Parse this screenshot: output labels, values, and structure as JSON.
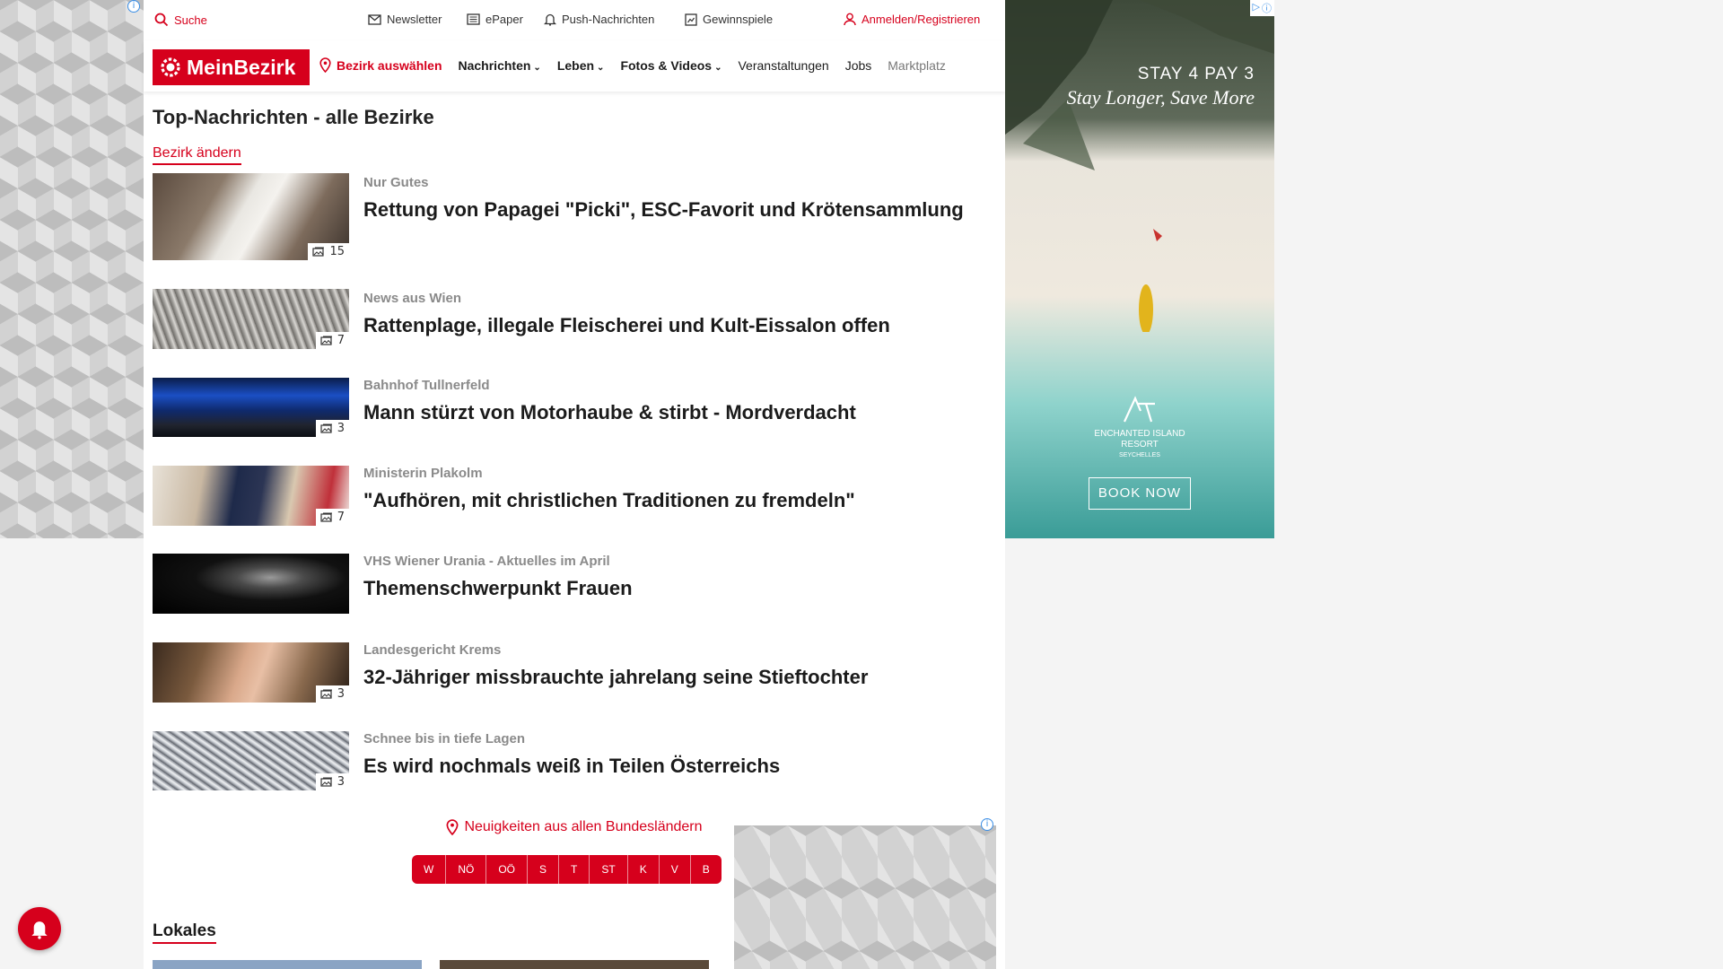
{
  "topbar": {
    "search": "Suche",
    "newsletter": "Newsletter",
    "epaper": "ePaper",
    "push": "Push-Nachrichten",
    "games": "Gewinnspiele",
    "login": "Anmelden/Registrieren"
  },
  "nav": {
    "logo": "MeinBezirk",
    "select_district": "Bezirk auswählen",
    "items": [
      "Nachrichten",
      "Leben",
      "Fotos & Videos",
      "Veranstaltungen",
      "Jobs",
      "Marktplatz"
    ]
  },
  "main": {
    "title": "Top-Nachrichten - alle Bezirke",
    "change_district": "Bezirk ändern",
    "articles": [
      {
        "kicker": "Nur Gutes",
        "headline": "Rettung von Papagei \"Picki\", ESC-Favorit und Krötensammlung",
        "photos": "15"
      },
      {
        "kicker": "News aus Wien",
        "headline": "Rattenplage, illegale Fleischerei und Kult-Eissalon offen",
        "photos": "7"
      },
      {
        "kicker": "Bahnhof Tullnerfeld",
        "headline": "Mann stürzt von Motorhaube & stirbt - Mordverdacht",
        "photos": "3"
      },
      {
        "kicker": "Ministerin Plakolm",
        "headline": "\"Aufhören, mit christlichen Traditionen zu fremdeln\"",
        "photos": "7"
      },
      {
        "kicker": "VHS Wiener Urania - Aktuelles im April",
        "headline": "Themenschwerpunkt Frauen",
        "photos": ""
      },
      {
        "kicker": "Landesgericht Krems",
        "headline": "32-Jähriger missbrauchte jahrelang seine Stieftochter",
        "photos": "3"
      },
      {
        "kicker": "Schnee bis in tiefe Lagen",
        "headline": "Es wird nochmals weiß in Teilen Österreichs",
        "photos": "3"
      }
    ],
    "states_title": "Neuigkeiten aus allen Bundesländern",
    "states": [
      "W",
      "NÖ",
      "OÖ",
      "S",
      "T",
      "ST",
      "K",
      "V",
      "B"
    ],
    "lokales": "Lokales"
  },
  "ad": {
    "line1": "STAY 4 PAY 3",
    "line2": "Stay Longer, Save More",
    "brand_line1": "ENCHANTED ISLAND",
    "brand_line2": "RESORT",
    "brand_line3": "SEYCHELLES",
    "cta": "BOOK NOW"
  },
  "colors": {
    "brand": "#d6001c"
  }
}
